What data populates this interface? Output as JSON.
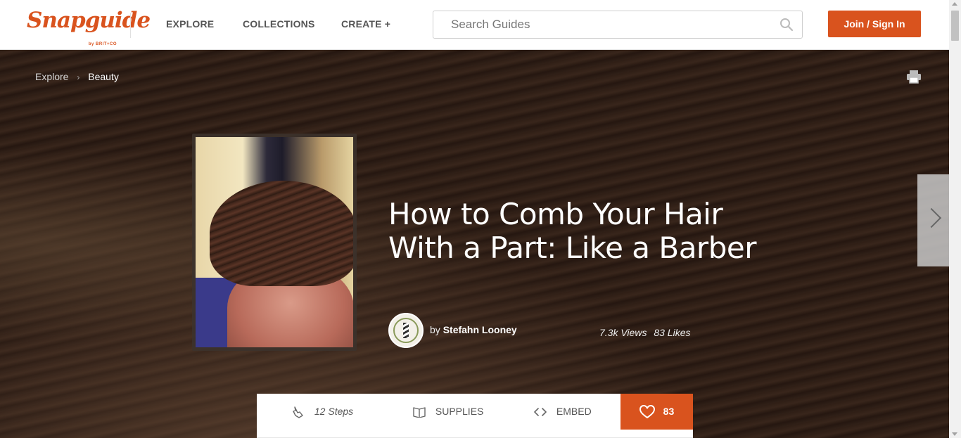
{
  "header": {
    "logo": "Snapguide",
    "logo_sub": "by BRIT+CO",
    "nav": [
      "EXPLORE",
      "COLLECTIONS",
      "CREATE +"
    ],
    "search_placeholder": "Search Guides",
    "join_label": "Join / Sign In",
    "accent_color": "#d9531e"
  },
  "breadcrumb": {
    "root": "Explore",
    "separator": "›",
    "current": "Beauty"
  },
  "guide": {
    "title": "How to Comb Your Hair With a Part: Like a Barber",
    "author_prefix": "by",
    "author": "Stefahn Looney",
    "views": "7.3k Views",
    "likes": "83 Likes"
  },
  "tabs": {
    "steps": "12 Steps",
    "supplies": "SUPPLIES",
    "embed": "EMBED",
    "like_count": "83"
  },
  "icons": {
    "search": "search-icon",
    "print": "print-icon",
    "next": "chevron-right-icon",
    "steps": "hand-pointer-icon",
    "supplies": "book-icon",
    "embed": "code-icon",
    "like": "heart-icon"
  }
}
